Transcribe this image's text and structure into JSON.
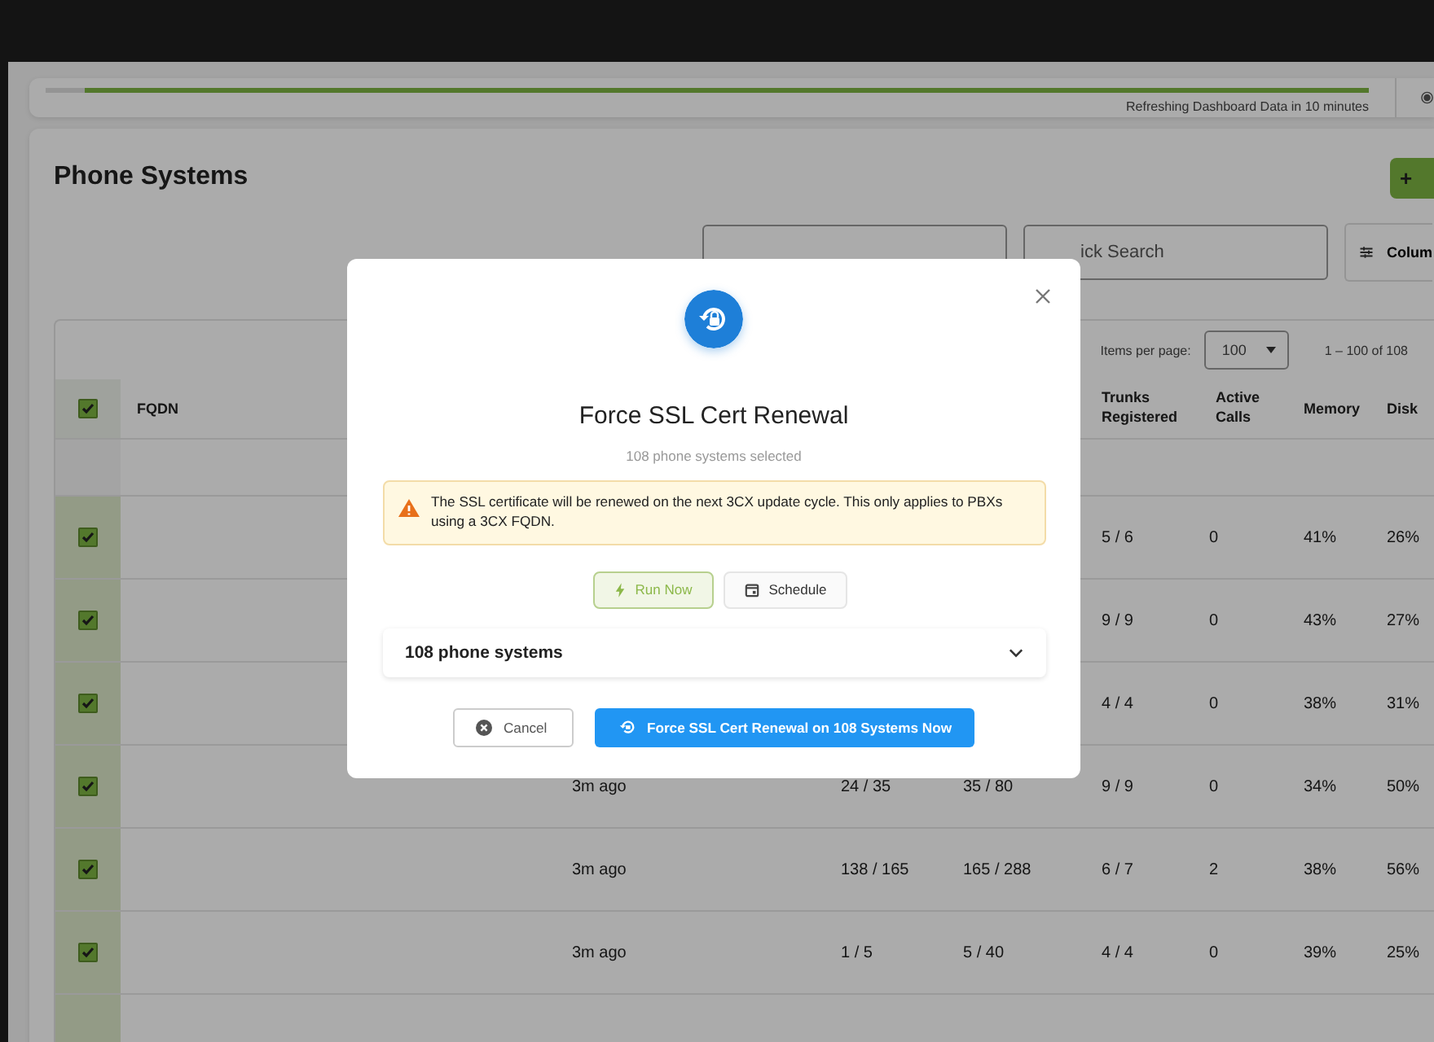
{
  "refresh": {
    "level": 0.97,
    "text": "Refreshing Dashboard Data in 10 minutes"
  },
  "page": {
    "title": "Phone Systems",
    "add_button": "+",
    "search_placeholder": "ick Search",
    "columns_button": "Colum"
  },
  "pagination": {
    "label": "Items per page:",
    "page_size": "100",
    "range": "1 – 100 of 108"
  },
  "table": {
    "all_checked": true,
    "columns": [
      "FQDN",
      "Trunks Registered",
      "Active Calls",
      "Memory",
      "Disk"
    ],
    "rows": [
      {
        "checked": true,
        "trunks": "5 / 6",
        "calls": "0",
        "memory": "41%",
        "disk": "26%"
      },
      {
        "checked": true,
        "trunks": "9 / 9",
        "calls": "0",
        "memory": "43%",
        "disk": "27%"
      },
      {
        "checked": true,
        "trunks": "4 / 4",
        "calls": "0",
        "memory": "38%",
        "disk": "31%"
      },
      {
        "checked": true,
        "last_seen": "3m ago",
        "column_5": "24 / 35",
        "column_6": "35 / 80",
        "trunks": "9 / 9",
        "calls": "0",
        "memory": "34%",
        "disk": "50%"
      },
      {
        "checked": true,
        "last_seen": "3m ago",
        "column_5": "138 / 165",
        "column_6": "165 / 288",
        "trunks": "6 / 7",
        "calls": "2",
        "memory": "38%",
        "disk": "56%"
      },
      {
        "checked": true,
        "last_seen": "3m ago",
        "column_5": "1 / 5",
        "column_6": "5 / 40",
        "trunks": "4 / 4",
        "calls": "0",
        "memory": "39%",
        "disk": "25%"
      }
    ]
  },
  "dialog": {
    "title": "Force SSL Cert Renewal",
    "subtitle": "108 phone systems selected",
    "warning": "The SSL certificate will be renewed on the next 3CX update cycle. This only applies to PBXs using a 3CX FQDN.",
    "modes": [
      {
        "label": "Run Now",
        "kind": "now",
        "selected": true
      },
      {
        "label": "Schedule",
        "kind": "schedule",
        "selected": false
      }
    ],
    "systems": {
      "label": "108 phone systems",
      "expanded": false
    },
    "cancel": "Cancel",
    "confirm": "Force SSL Cert Renewal on 108 Systems Now"
  }
}
